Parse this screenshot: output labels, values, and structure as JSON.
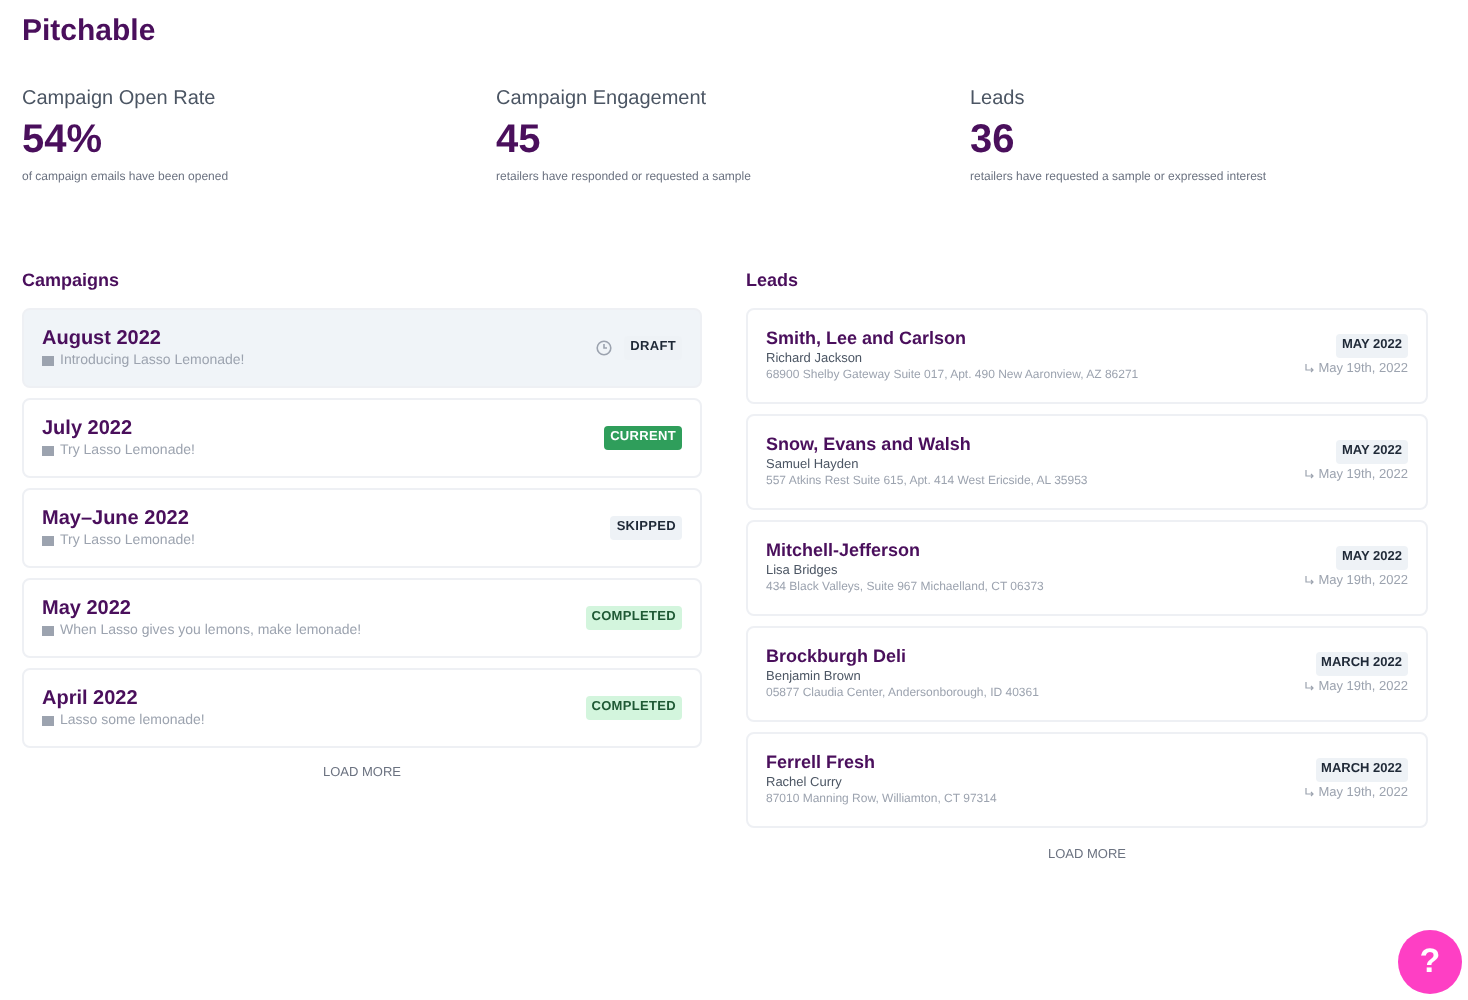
{
  "app_title": "Pitchable",
  "stats": [
    {
      "label": "Campaign Open Rate",
      "value": "54%",
      "caption": "of campaign emails have been opened"
    },
    {
      "label": "Campaign Engagement",
      "value": "45",
      "caption": "retailers have responded or requested a sample"
    },
    {
      "label": "Leads",
      "value": "36",
      "caption": "retailers have requested a sample or expressed interest"
    }
  ],
  "campaigns": {
    "heading": "Campaigns",
    "load_more": "LOAD MORE",
    "items": [
      {
        "title": "August 2022",
        "subject": "Introducing Lasso Lemonade!",
        "status": "DRAFT",
        "kind": "draft",
        "selected": true
      },
      {
        "title": "July 2022",
        "subject": "Try Lasso Lemonade!",
        "status": "CURRENT",
        "kind": "current",
        "selected": false
      },
      {
        "title": "May–June 2022",
        "subject": "Try Lasso Lemonade!",
        "status": "SKIPPED",
        "kind": "skipped",
        "selected": false
      },
      {
        "title": "May 2022",
        "subject": "When Lasso gives you lemons, make lemonade!",
        "status": "COMPLETED",
        "kind": "completed",
        "selected": false
      },
      {
        "title": "April 2022",
        "subject": "Lasso some lemonade!",
        "status": "COMPLETED",
        "kind": "completed",
        "selected": false
      }
    ]
  },
  "leads": {
    "heading": "Leads",
    "load_more": "LOAD MORE",
    "items": [
      {
        "company": "Smith, Lee and Carlson",
        "contact": "Richard Jackson",
        "address": "68900 Shelby Gateway Suite 017, Apt. 490 New Aaronview, AZ 86271",
        "campaign": "MAY 2022",
        "date": "May 19th, 2022"
      },
      {
        "company": "Snow, Evans and Walsh",
        "contact": "Samuel Hayden",
        "address": "557 Atkins Rest Suite 615, Apt. 414 West Ericside, AL 35953",
        "campaign": "MAY 2022",
        "date": "May 19th, 2022"
      },
      {
        "company": "Mitchell-Jefferson",
        "contact": "Lisa Bridges",
        "address": "434 Black Valleys, Suite 967 Michaelland, CT 06373",
        "campaign": "MAY 2022",
        "date": "May 19th, 2022"
      },
      {
        "company": "Brockburgh Deli",
        "contact": "Benjamin Brown",
        "address": "05877 Claudia Center, Andersonborough, ID 40361",
        "campaign": "MARCH 2022",
        "date": "May 19th, 2022"
      },
      {
        "company": "Ferrell Fresh",
        "contact": "Rachel Curry",
        "address": "87010 Manning Row, Williamton, CT 97314",
        "campaign": "MARCH 2022",
        "date": "May 19th, 2022"
      }
    ]
  },
  "help_button": "?"
}
